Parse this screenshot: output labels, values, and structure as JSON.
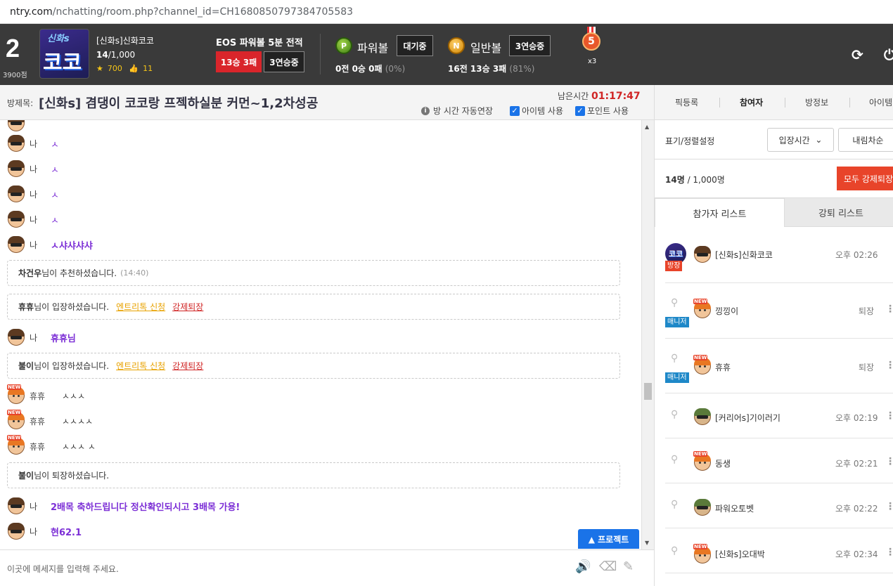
{
  "browser": {
    "url_main": "ntry.com",
    "url_rest": "/nchatting/room.php?channel_id=CH1680850797384705583"
  },
  "header": {
    "level": "2",
    "points": "3900점",
    "logo_top": "신화s",
    "logo_main": "코코",
    "room_name": "[신화s]신화코코",
    "count_current": "14",
    "count_max": "/1,000",
    "stars": "700",
    "likes": "11",
    "eos_title": "EOS 파워볼 5분 전적",
    "eos_record": "13승 3패",
    "eos_streak": "3연승중",
    "powerball_icon": "P",
    "powerball_label": "파워볼",
    "powerball_status": "대기중",
    "powerball_record": "0전 0승 0패",
    "powerball_pct": "(0%)",
    "normalball_icon": "N",
    "normalball_label": "일반볼",
    "normalball_streak": "3연승중",
    "normalball_record": "16전 13승 3패",
    "normalball_pct": "(81%)",
    "medal_num": "5",
    "medal_mult": "x3"
  },
  "titlebar": {
    "label": "방제목:",
    "title": "[신화s] 겸댕이 코코랑 프젝하실분 커먼~1,2차성공",
    "remain_label": "남은시간",
    "remain_time": "01:17:47",
    "auto_extend": "방 시간 자동연장",
    "item_use": "아이템 사용",
    "point_use": "포인트 사용"
  },
  "chat": {
    "rows": [
      {
        "nick": "나",
        "text": "ㅅ"
      },
      {
        "nick": "나",
        "text": "ㅅ"
      },
      {
        "nick": "나",
        "text": "ㅅ"
      },
      {
        "nick": "나",
        "text": "ㅅ"
      },
      {
        "nick": "나",
        "text": "ㅅ샤샤샤샤"
      }
    ],
    "notice1": {
      "name": "차건우",
      "text": "님이 추천하셨습니다.",
      "time": "(14:40)"
    },
    "notice2": {
      "name": "휴휴",
      "text": "님이 입장하셨습니다.",
      "link1": "엔트리톡 신청",
      "link2": "강제퇴장"
    },
    "row_huhu": {
      "nick": "나",
      "text": "휴휴님"
    },
    "notice3": {
      "name": "불이",
      "text": "님이 입장하셨습니다.",
      "link1": "엔트리톡 신청",
      "link2": "강제퇴장"
    },
    "new_rows": [
      {
        "nick": "휴휴",
        "text": "ㅅㅅㅅ"
      },
      {
        "nick": "휴휴",
        "text": "ㅅㅅㅅㅅ"
      },
      {
        "nick": "휴휴",
        "text": "ㅅㅅㅅ ㅅ"
      }
    ],
    "notice4": {
      "name": "불이",
      "text": "님이 퇴장하셨습니다."
    },
    "row_last1": {
      "nick": "나",
      "text": "2배목 축하드립니다 정산확인되시고 3배목 가용!"
    },
    "row_last2": {
      "nick": "나",
      "text": "현62.1"
    },
    "project_btn": "▲ 프로젝트"
  },
  "input": {
    "placeholder": "이곳에 메세지를 입력해 주세요."
  },
  "right": {
    "tabs": [
      "픽등록",
      "참여자",
      "방정보",
      "아이템"
    ],
    "sort_label": "표기/정렬설정",
    "sort_select": "입장시간",
    "order_select": "내림차순",
    "count_num": "14명",
    "count_max": " / 1,000명",
    "kick_all": "모두 강제퇴장",
    "list_tab_on": "참가자 리스트",
    "list_tab_off": "강퇴 리스트",
    "users": [
      {
        "name": "[신화s]신화코코",
        "time": "오후 02:26",
        "role": "방장"
      },
      {
        "name": "낑낑이",
        "kick": "퇴장",
        "role": "매니저"
      },
      {
        "name": "휴휴",
        "kick": "퇴장",
        "role": "매니저"
      },
      {
        "name": "[커리어s]기이러기",
        "time": "오후 02:19"
      },
      {
        "name": "동생",
        "time": "오후 02:21"
      },
      {
        "name": "파워오토벳",
        "time": "오후 02:22"
      },
      {
        "name": "[신화s]오대박",
        "time": "오후 02:34"
      }
    ]
  }
}
